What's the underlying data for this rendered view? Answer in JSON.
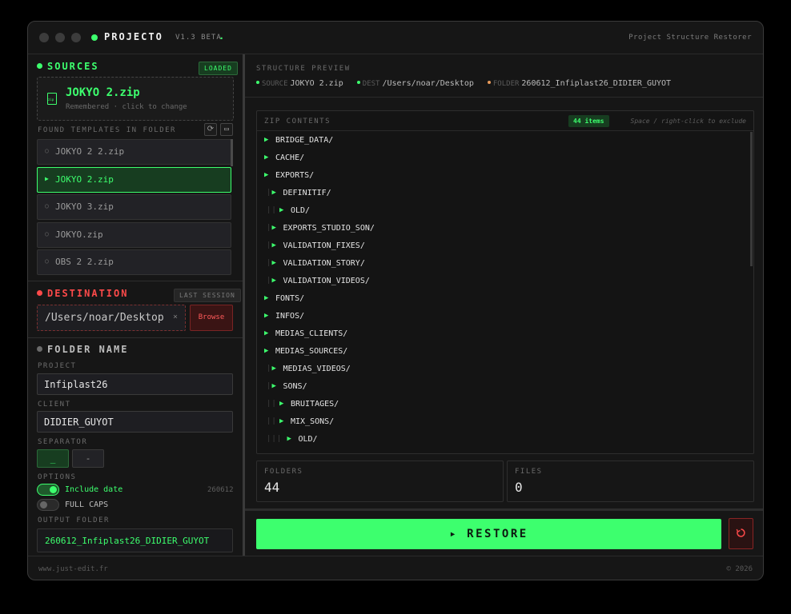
{
  "app": {
    "title": "PROJECTO",
    "version": "V1.3 BETA",
    "version_dot": ".",
    "subtitle": "Project Structure Restorer"
  },
  "sources": {
    "title": "SOURCES",
    "badge": "LOADED",
    "selected_name": "JOKYO 2.zip",
    "selected_sub": "Remembered · click to change",
    "found_label": "FOUND TEMPLATES IN FOLDER",
    "templates": [
      {
        "name": "JOKYO 2 2.zip",
        "active": false
      },
      {
        "name": "JOKYO 2.zip",
        "active": true
      },
      {
        "name": "JOKYO 3.zip",
        "active": false
      },
      {
        "name": "JOKYO.zip",
        "active": false
      },
      {
        "name": "OBS 2 2.zip",
        "active": false
      }
    ]
  },
  "destination": {
    "title": "DESTINATION",
    "badge": "LAST SESSION",
    "path": "/Users/noar/Desktop",
    "clear": "×",
    "browse_label": "Browse"
  },
  "folder_name": {
    "title": "FOLDER NAME",
    "project_label": "PROJECT",
    "project_value": "Infiplast26",
    "client_label": "CLIENT",
    "client_value": "DIDIER_GUYOT",
    "separator_label": "SEPARATOR",
    "separators": [
      "_",
      "-"
    ],
    "options_label": "OPTIONS",
    "include_date_label": "Include date",
    "include_date_on": true,
    "date_value": "260612",
    "full_caps_label": "FULL CAPS",
    "full_caps_on": false,
    "output_label": "OUTPUT FOLDER",
    "output_value": "260612_Infiplast26_DIDIER_GUYOT"
  },
  "preview": {
    "title": "STRUCTURE PREVIEW",
    "source_key": "SOURCE",
    "source_value": "JOKYO 2.zip",
    "dest_key": "DEST",
    "dest_value": "/Users/noar/Desktop",
    "folder_key": "FOLDER",
    "folder_value": "260612_Infiplast26_DIDIER_GUYOT"
  },
  "zip": {
    "title": "ZIP CONTENTS",
    "count": "44 items",
    "hint": "Space / right-click to exclude",
    "tree": [
      {
        "name": "BRIDGE_DATA/",
        "depth": 0
      },
      {
        "name": "CACHE/",
        "depth": 0
      },
      {
        "name": "EXPORTS/",
        "depth": 0
      },
      {
        "name": "DEFINITIF/",
        "depth": 1
      },
      {
        "name": "OLD/",
        "depth": 2
      },
      {
        "name": "EXPORTS_STUDIO_SON/",
        "depth": 1
      },
      {
        "name": "VALIDATION_FIXES/",
        "depth": 1
      },
      {
        "name": "VALIDATION_STORY/",
        "depth": 1
      },
      {
        "name": "VALIDATION_VIDEOS/",
        "depth": 1
      },
      {
        "name": "FONTS/",
        "depth": 0
      },
      {
        "name": "INFOS/",
        "depth": 0
      },
      {
        "name": "MEDIAS_CLIENTS/",
        "depth": 0
      },
      {
        "name": "MEDIAS_SOURCES/",
        "depth": 0
      },
      {
        "name": "MEDIAS_VIDEOS/",
        "depth": 1
      },
      {
        "name": "SONS/",
        "depth": 1
      },
      {
        "name": "BRUITAGES/",
        "depth": 2
      },
      {
        "name": "MIX_SONS/",
        "depth": 2
      },
      {
        "name": "OLD/",
        "depth": 3
      }
    ]
  },
  "stats": {
    "folders_label": "FOLDERS",
    "folders_value": "44",
    "files_label": "FILES",
    "files_value": "0"
  },
  "actions": {
    "restore_label": "▸ RESTORE",
    "reset_icon": "reset-icon"
  },
  "footer": {
    "left": "www.just-edit.fr",
    "right": "© 2026"
  },
  "colors": {
    "accent": "#3dff6e",
    "danger": "#ff4a4a",
    "bg": "#161616"
  }
}
